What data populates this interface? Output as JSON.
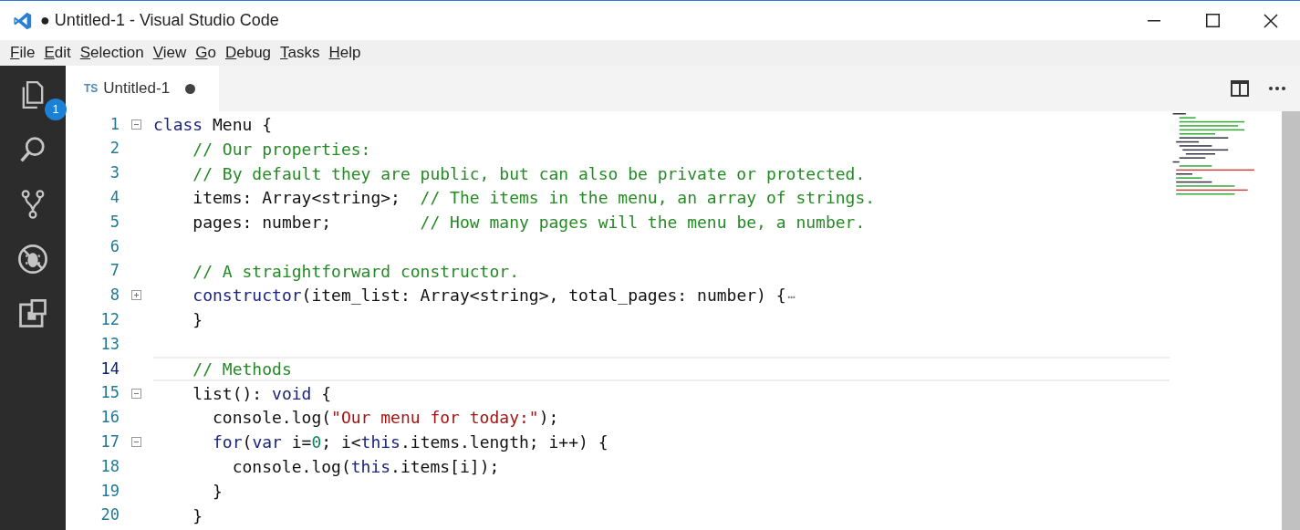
{
  "window": {
    "title": "● Untitled-1 - Visual Studio Code"
  },
  "menu": [
    "File",
    "Edit",
    "Selection",
    "View",
    "Go",
    "Debug",
    "Tasks",
    "Help"
  ],
  "activity_bar": [
    {
      "kind": "explorer",
      "selected": false,
      "badge": "1"
    },
    {
      "kind": "search",
      "selected": false
    },
    {
      "kind": "source-control",
      "selected": false
    },
    {
      "kind": "debug",
      "selected": false
    },
    {
      "kind": "extensions",
      "selected": false
    }
  ],
  "tabs": [
    {
      "language": "TS",
      "label": "Untitled-1",
      "selected": true,
      "dirty": true
    }
  ],
  "editor": {
    "lines": [
      {
        "number": "1",
        "folded": false,
        "tokens": [
          {
            "kind": "keyword",
            "text": "class"
          },
          {
            "kind": "plain",
            "text": " Menu {"
          }
        ]
      },
      {
        "number": "2",
        "tokens": [
          {
            "kind": "comment",
            "text": "    // Our properties:"
          }
        ]
      },
      {
        "number": "3",
        "tokens": [
          {
            "kind": "comment",
            "text": "    // By default they are public, but can also be private or protected."
          }
        ]
      },
      {
        "number": "4",
        "tokens": [
          {
            "kind": "plain",
            "text": "    items: Array<string>;  "
          },
          {
            "kind": "comment",
            "text": "// The items in the menu, an array of strings."
          }
        ]
      },
      {
        "number": "5",
        "tokens": [
          {
            "kind": "plain",
            "text": "    pages: number;         "
          },
          {
            "kind": "comment",
            "text": "// How many pages will the menu be, a number."
          }
        ]
      },
      {
        "number": "6"
      },
      {
        "number": "7",
        "tokens": [
          {
            "kind": "comment",
            "text": "    // A straightforward constructor."
          }
        ]
      },
      {
        "number": "8",
        "folded": true,
        "tokens": [
          {
            "kind": "keyword",
            "text": "    constructor"
          },
          {
            "kind": "plain",
            "text": "(item_list: Array<string>, total_pages: number) {"
          },
          {
            "kind": "ellipsis",
            "text": "⋯"
          }
        ]
      },
      {
        "number": "12",
        "tokens": [
          {
            "kind": "plain",
            "text": "    }"
          }
        ]
      },
      {
        "number": "13"
      },
      {
        "number": "14",
        "current": true,
        "tokens": [
          {
            "kind": "comment",
            "text": "    // Methods"
          }
        ]
      },
      {
        "number": "15",
        "folded": false,
        "tokens": [
          {
            "kind": "plain",
            "text": "    list(): "
          },
          {
            "kind": "keyword",
            "text": "void"
          },
          {
            "kind": "plain",
            "text": " {"
          }
        ]
      },
      {
        "number": "16",
        "tokens": [
          {
            "kind": "plain",
            "text": "      console.log("
          },
          {
            "kind": "string",
            "text": "\"Our menu for today:\""
          },
          {
            "kind": "plain",
            "text": ");"
          }
        ]
      },
      {
        "number": "17",
        "folded": false,
        "tokens": [
          {
            "kind": "keyword",
            "text": "      for"
          },
          {
            "kind": "plain",
            "text": "("
          },
          {
            "kind": "keyword",
            "text": "var"
          },
          {
            "kind": "plain",
            "text": " i="
          },
          {
            "kind": "number",
            "text": "0"
          },
          {
            "kind": "plain",
            "text": "; i<"
          },
          {
            "kind": "keyword",
            "text": "this"
          },
          {
            "kind": "plain",
            "text": ".items.length; i++) {"
          }
        ]
      },
      {
        "number": "18",
        "tokens": [
          {
            "kind": "plain",
            "text": "        console.log("
          },
          {
            "kind": "keyword",
            "text": "this"
          },
          {
            "kind": "plain",
            "text": ".items[i]);"
          }
        ]
      },
      {
        "number": "19",
        "tokens": [
          {
            "kind": "plain",
            "text": "      }"
          }
        ]
      },
      {
        "number": "20",
        "tokens": [
          {
            "kind": "plain",
            "text": "    }"
          }
        ]
      }
    ]
  }
}
